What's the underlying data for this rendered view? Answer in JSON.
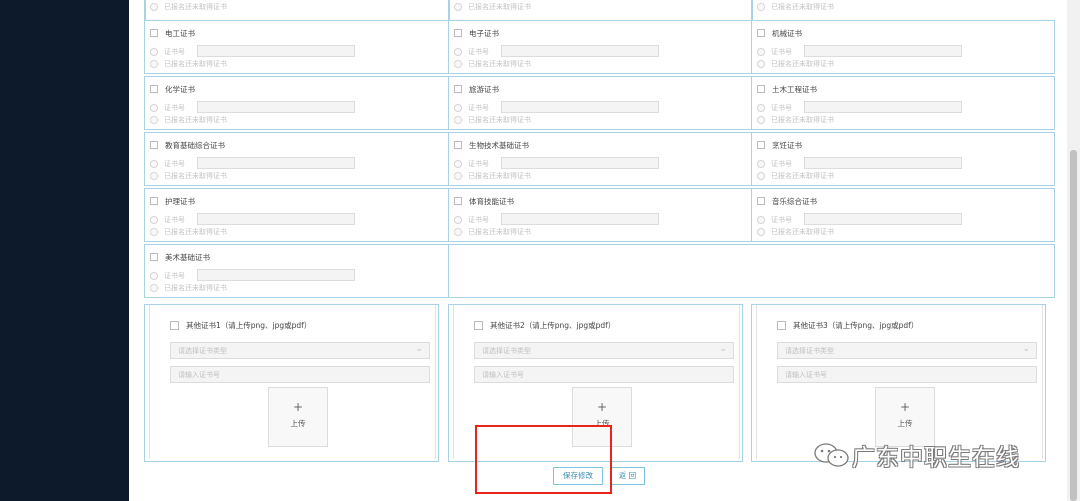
{
  "certificates": {
    "top_partial": [
      {
        "status_label": "已报名还未取得证书"
      },
      {
        "status_label": "已报名还未取得证书"
      },
      {
        "status_label": "已报名还未取得证书"
      }
    ],
    "rows": [
      [
        {
          "name": "电工证书",
          "number_label": "证书号",
          "status_label": "已报名还未取得证书"
        },
        {
          "name": "电子证书",
          "number_label": "证书号",
          "status_label": "已报名还未取得证书"
        },
        {
          "name": "机械证书",
          "number_label": "证书号",
          "status_label": "已报名还未取得证书"
        }
      ],
      [
        {
          "name": "化学证书",
          "number_label": "证书号",
          "status_label": "已报名还未取得证书"
        },
        {
          "name": "旅游证书",
          "number_label": "证书号",
          "status_label": "已报名还未取得证书"
        },
        {
          "name": "土木工程证书",
          "number_label": "证书号",
          "status_label": "已报名还未取得证书"
        }
      ],
      [
        {
          "name": "教育基础综合证书",
          "number_label": "证书号",
          "status_label": "已报名还未取得证书"
        },
        {
          "name": "生物技术基础证书",
          "number_label": "证书号",
          "status_label": "已报名还未取得证书"
        },
        {
          "name": "烹饪证书",
          "number_label": "证书号",
          "status_label": "已报名还未取得证书"
        }
      ],
      [
        {
          "name": "护理证书",
          "number_label": "证书号",
          "status_label": "已报名还未取得证书"
        },
        {
          "name": "体育技能证书",
          "number_label": "证书号",
          "status_label": "已报名还未取得证书"
        },
        {
          "name": "音乐综合证书",
          "number_label": "证书号",
          "status_label": "已报名还未取得证书"
        }
      ],
      [
        {
          "name": "美术基础证书",
          "number_label": "证书号",
          "status_label": "已报名还未取得证书"
        }
      ]
    ]
  },
  "other_certificates": [
    {
      "title": "其他证书1（请上传png、jpg或pdf）",
      "type_placeholder": "请选择证书类型",
      "number_placeholder": "请输入证书号",
      "upload_plus": "+",
      "upload_label": "上传"
    },
    {
      "title": "其他证书2（请上传png、jpg或pdf）",
      "type_placeholder": "请选择证书类型",
      "number_placeholder": "请输入证书号",
      "upload_plus": "+",
      "upload_label": "上传"
    },
    {
      "title": "其他证书3（请上传png、jpg或pdf）",
      "type_placeholder": "请选择证书类型",
      "number_placeholder": "请输入证书号",
      "upload_plus": "+",
      "upload_label": "上传"
    }
  ],
  "actions": {
    "save_label": "保存修改",
    "back_label": "返 回"
  },
  "watermark": {
    "text": "广东中职生在线"
  },
  "colors": {
    "sidebar": "#0c1a2b",
    "border": "#a8d3e6",
    "button_text": "#3a8db0",
    "highlight": "#e8241c"
  }
}
